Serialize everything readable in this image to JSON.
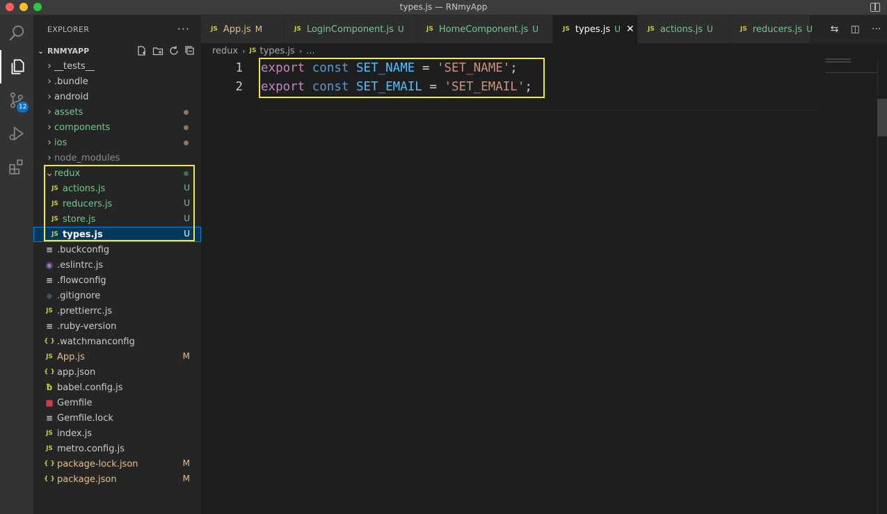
{
  "window": {
    "title": "types.js — RNmyApp"
  },
  "activity": {
    "badge": "12"
  },
  "explorer": {
    "header": "EXPLORER",
    "menu": "···",
    "project": "RNMYAPP",
    "items": [
      {
        "label": "__tests__",
        "type": "folder",
        "icon": "folder-icon"
      },
      {
        "label": ".bundle",
        "type": "folder",
        "icon": "folder-icon"
      },
      {
        "label": "android",
        "type": "folder",
        "icon": "folder-icon"
      },
      {
        "label": "assets",
        "type": "folder",
        "icon": "folder-icon"
      },
      {
        "label": "components",
        "type": "folder",
        "icon": "folder-icon"
      },
      {
        "label": "ios",
        "type": "folder",
        "icon": "folder-icon"
      },
      {
        "label": "node_modules",
        "type": "folder",
        "icon": "folder-icon"
      },
      {
        "label": "redux",
        "type": "folder-open",
        "icon": "folder-icon"
      },
      {
        "label": "actions.js",
        "type": "file",
        "icon": "js-file-icon",
        "status": "U"
      },
      {
        "label": "reducers.js",
        "type": "file",
        "icon": "js-file-icon",
        "status": "U"
      },
      {
        "label": "store.js",
        "type": "file",
        "icon": "js-file-icon",
        "status": "U"
      },
      {
        "label": "types.js",
        "type": "file",
        "icon": "js-file-icon",
        "status": "U"
      },
      {
        "label": ".buckconfig",
        "type": "file",
        "icon": "lines-file-icon"
      },
      {
        "label": ".eslintrc.js",
        "type": "file",
        "icon": "eslint-icon"
      },
      {
        "label": ".flowconfig",
        "type": "file",
        "icon": "lines-file-icon"
      },
      {
        "label": ".gitignore",
        "type": "file",
        "icon": "git-icon"
      },
      {
        "label": ".prettierrc.js",
        "type": "file",
        "icon": "js-file-icon"
      },
      {
        "label": ".ruby-version",
        "type": "file",
        "icon": "lines-file-icon"
      },
      {
        "label": ".watchmanconfig",
        "type": "file",
        "icon": "json-icon"
      },
      {
        "label": "App.js",
        "type": "file",
        "icon": "js-file-icon",
        "status": "M"
      },
      {
        "label": "app.json",
        "type": "file",
        "icon": "json-icon"
      },
      {
        "label": "babel.config.js",
        "type": "file",
        "icon": "babel-icon"
      },
      {
        "label": "Gemfile",
        "type": "file",
        "icon": "ruby-icon"
      },
      {
        "label": "Gemfile.lock",
        "type": "file",
        "icon": "lines-file-icon"
      },
      {
        "label": "index.js",
        "type": "file",
        "icon": "js-file-icon"
      },
      {
        "label": "metro.config.js",
        "type": "file",
        "icon": "js-file-icon"
      },
      {
        "label": "package-lock.json",
        "type": "file",
        "icon": "json-icon",
        "status": "M"
      },
      {
        "label": "package.json",
        "type": "file",
        "icon": "json-icon",
        "status": "M"
      }
    ]
  },
  "tabs": [
    {
      "label": "App.js",
      "status": "M"
    },
    {
      "label": "LoginComponent.js",
      "status": "U"
    },
    {
      "label": "HomeComponent.js",
      "status": "U"
    },
    {
      "label": "types.js",
      "status": "U"
    },
    {
      "label": "actions.js",
      "status": "U"
    },
    {
      "label": "reducers.js",
      "status": "U"
    }
  ],
  "tab_icon": "JS",
  "breadcrumb": {
    "folder": "redux",
    "file": "types.js",
    "more": "..."
  },
  "code": {
    "lines": [
      {
        "num": "1",
        "kw": "export",
        "kw2": "const",
        "name": "SET_NAME",
        "op": "=",
        "str": "'SET_NAME'",
        "end": ";"
      },
      {
        "num": "2",
        "kw": "export",
        "kw2": "const",
        "name": "SET_EMAIL",
        "op": "=",
        "str": "'SET_EMAIL'",
        "end": ";"
      }
    ]
  },
  "colors": {
    "highlight": "#f0ea3c",
    "selection": "#04395e",
    "untracked": "#73c991",
    "modified": "#e2c08d"
  }
}
